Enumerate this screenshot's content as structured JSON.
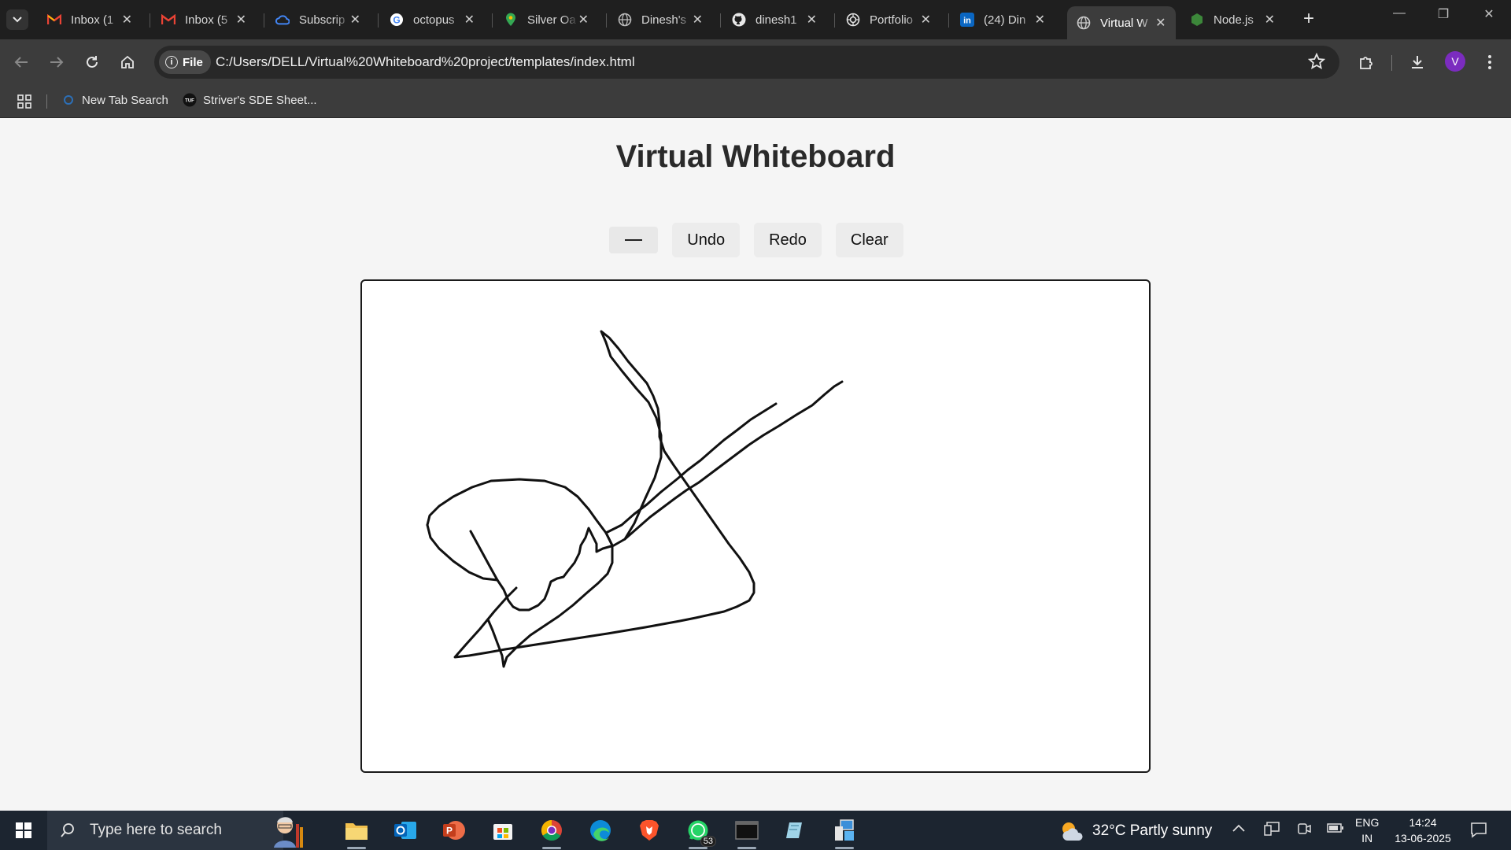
{
  "browser": {
    "tabs": [
      {
        "label": "Inbox (1",
        "icon": "gmail-icon"
      },
      {
        "label": "Inbox (5",
        "icon": "gmail-icon"
      },
      {
        "label": "Subscrip",
        "icon": "cloud-icon"
      },
      {
        "label": "octopus",
        "icon": "google-icon"
      },
      {
        "label": "Silver Oa",
        "icon": "maps-pin-icon"
      },
      {
        "label": "Dinesh's",
        "icon": "globe-icon"
      },
      {
        "label": "dinesh1",
        "icon": "github-icon"
      },
      {
        "label": "Portfolio",
        "icon": "openai-icon"
      },
      {
        "label": "(24) Din",
        "icon": "linkedin-icon"
      },
      {
        "label": "Virtual W",
        "icon": "globe-icon",
        "active": true
      },
      {
        "label": "Node.js",
        "icon": "nodejs-icon"
      }
    ],
    "address": {
      "chip": "File",
      "url": "C:/Users/DELL/Virtual%20Whiteboard%20project/templates/index.html"
    },
    "profile_initial": "V",
    "bookmarks": [
      {
        "label": "New Tab Search"
      },
      {
        "label": "Striver's SDE Sheet..."
      }
    ]
  },
  "page": {
    "title": "Virtual Whiteboard",
    "buttons": {
      "undo": "Undo",
      "redo": "Redo",
      "clear": "Clear"
    },
    "pen_color": "#222222"
  },
  "taskbar": {
    "search_placeholder": "Type here to search",
    "whatsapp_badge": "53",
    "weather": "32°C  Partly sunny",
    "lang_top": "ENG",
    "lang_bottom": "IN",
    "time": "14:24",
    "date": "13-06-2025"
  },
  "colors": {
    "tabstrip": "#1f1f1f",
    "toolbar": "#3c3c3c",
    "page_bg": "#f5f5f5",
    "taskbar": "#1c2530"
  }
}
